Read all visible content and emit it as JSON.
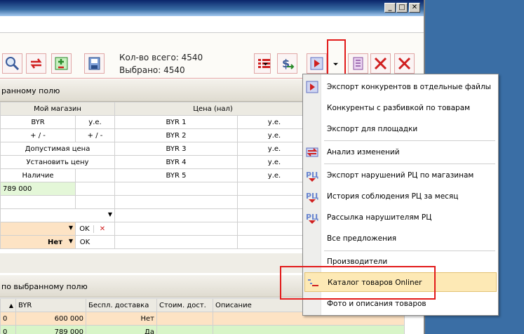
{
  "stats": {
    "total": "Кол-во всего: 4540",
    "selected": "Выбрано: 4540"
  },
  "panel_top": {
    "caption": "ранному полю"
  },
  "panel_bottom": {
    "caption": "по выбранному полю"
  },
  "grid1": {
    "head_left": "Мой магазин",
    "head_right": "Цена (нал)",
    "rows": [
      {
        "a": "BYR",
        "b": "у.е.",
        "c": "BYR 1",
        "d": "у.е."
      },
      {
        "a": "+ / -",
        "b": "+ / -",
        "c": "BYR 2",
        "d": "у.е."
      },
      {
        "a": "Допустимая цена",
        "b": "",
        "c": "BYR 3",
        "d": "у.е."
      },
      {
        "a": "Установить цену",
        "b": "",
        "c": "BYR 4",
        "d": "у.е."
      },
      {
        "a": "Наличие",
        "b": "",
        "c": "BYR 5",
        "d": "у.е."
      }
    ],
    "value_row": "789 000",
    "ok1": "OK",
    "cancel_x": "✕",
    "filter_value": "Нет",
    "ok2": "OK"
  },
  "grid2": {
    "headers": [
      "BYR",
      "Беспл. доставка",
      "Стоим. дост.",
      "Описание"
    ],
    "rows": [
      {
        "idx": "0",
        "byr": "600 000",
        "free": "Нет",
        "cost": "",
        "desc": ""
      },
      {
        "idx": "0",
        "byr": "789 000",
        "free": "Да",
        "cost": "",
        "desc": ""
      }
    ]
  },
  "menu": {
    "items": [
      {
        "label": "Экспорт конкурентов в отдельные файлы",
        "icon": "export-icon"
      },
      {
        "label": "Конкуренты с разбивкой по товарам",
        "icon": ""
      },
      {
        "label": "Экспорт для площадки",
        "icon": ""
      },
      {
        "label": "Анализ изменений",
        "icon": "analysis-icon"
      },
      {
        "label": "Экспорт нарушений РЦ по магазинам",
        "icon": "rc-icon"
      },
      {
        "label": "История соблюдения РЦ за месяц",
        "icon": "rc-icon"
      },
      {
        "label": "Рассылка нарушителям РЦ",
        "icon": "rc-icon"
      },
      {
        "label": "Все предложения",
        "icon": ""
      },
      {
        "label": "Производители",
        "icon": ""
      },
      {
        "label": "Каталог товаров Onliner",
        "icon": "catalog-icon"
      },
      {
        "label": "Фото и описания товаров",
        "icon": ""
      }
    ]
  },
  "colors": {
    "accent_red": "#e21a1a",
    "highlight": "#fde9b5",
    "green_row": "#d8f5c8",
    "orange_row": "#fde3c4"
  }
}
